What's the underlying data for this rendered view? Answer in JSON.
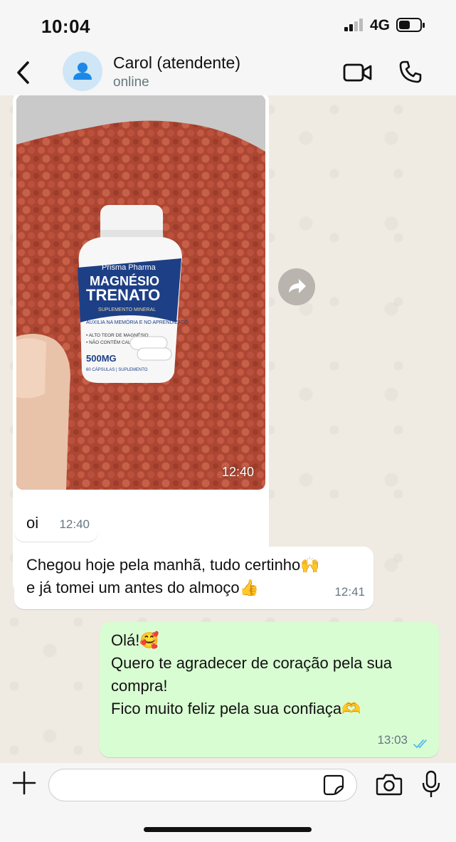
{
  "status_bar": {
    "time": "10:04",
    "network": "4G",
    "battery_level": 0.55
  },
  "header": {
    "contact_name": "Carol (atendente)",
    "contact_status": "online"
  },
  "messages": {
    "image_message": {
      "time": "12:40",
      "product_brand": "Prisma Pharma",
      "product_name_line1": "MAGNÉSIO",
      "product_name_line2": "TRENATO",
      "product_subtitle": "SUPLEMENTO MINERAL",
      "product_claim": "AUXILIA NA MEMÓRIA E NO APRENDIZADO",
      "product_bullet1": "• ALTO TEOR DE MAGNÉSIO",
      "product_bullet2": "• NÃO CONTÉM CALORIAS",
      "product_dose": "500MG",
      "product_count": "60 CÁPSULAS | SUPLEMENTO"
    },
    "oi": {
      "text": "oi",
      "time": "12:40"
    },
    "chegou": {
      "line1": "Chegou hoje pela manhã, tudo certinho🙌",
      "line2": "e já tomei um antes do almoço👍",
      "time": "12:41"
    },
    "outgoing": {
      "line1": "Olá!🥰",
      "line2": "Quero te agradecer de coração pela sua",
      "line3": "compra!",
      "line4": "Fico muito feliz pela sua confiaça🫶",
      "time": "13:03",
      "status": "read"
    }
  },
  "composer": {
    "placeholder": ""
  },
  "colors": {
    "chat_bg": "#efeae2",
    "incoming_bubble": "#ffffff",
    "outgoing_bubble": "#d9fdd3",
    "read_ticks": "#53bdeb",
    "bar_bg": "#f6f6f6"
  },
  "icons": {
    "back": "chevron-left-icon",
    "avatar": "person-icon",
    "video": "video-camera-icon",
    "call": "phone-icon",
    "forward": "forward-arrow-icon",
    "plus": "plus-icon",
    "sticker": "sticker-icon",
    "camera": "camera-icon",
    "mic": "microphone-icon"
  }
}
